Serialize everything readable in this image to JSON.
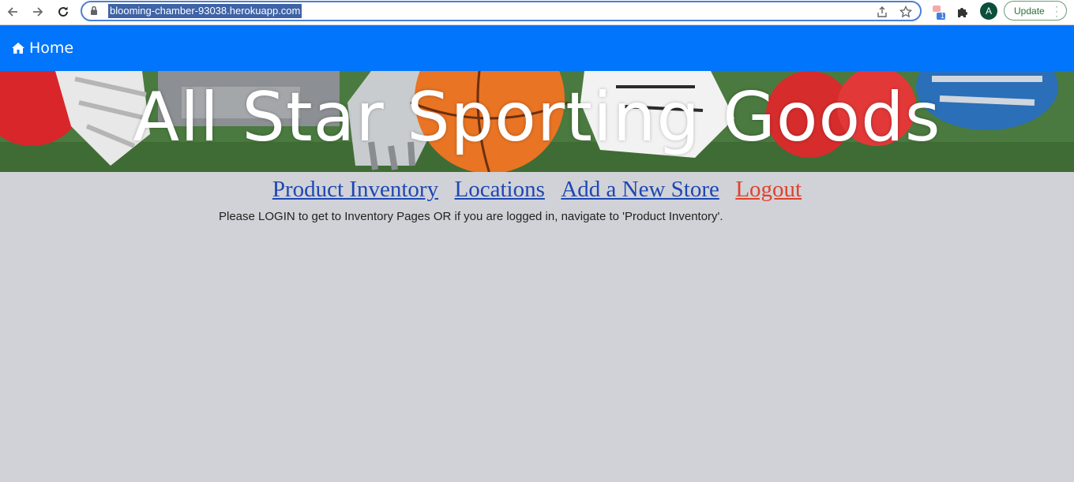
{
  "browser": {
    "url": "blooming-chamber-93038.herokuapp.com",
    "profile_initial": "A",
    "update_label": "Update",
    "extension_badge": "1"
  },
  "navbar": {
    "home_label": "Home",
    "home_icon": "home-icon",
    "background": "#0275fd"
  },
  "hero": {
    "title": "All Star Sporting Goods"
  },
  "links": {
    "product_inventory": "Product Inventory",
    "locations": "Locations",
    "add_store": "Add a New Store",
    "logout": "Logout"
  },
  "message": "Please LOGIN to get to Inventory Pages OR if you are logged in, navigate to 'Product Inventory'.",
  "colors": {
    "link": "#1d47b4",
    "logout": "#e0412c",
    "page_background": "#d1d2d7"
  }
}
